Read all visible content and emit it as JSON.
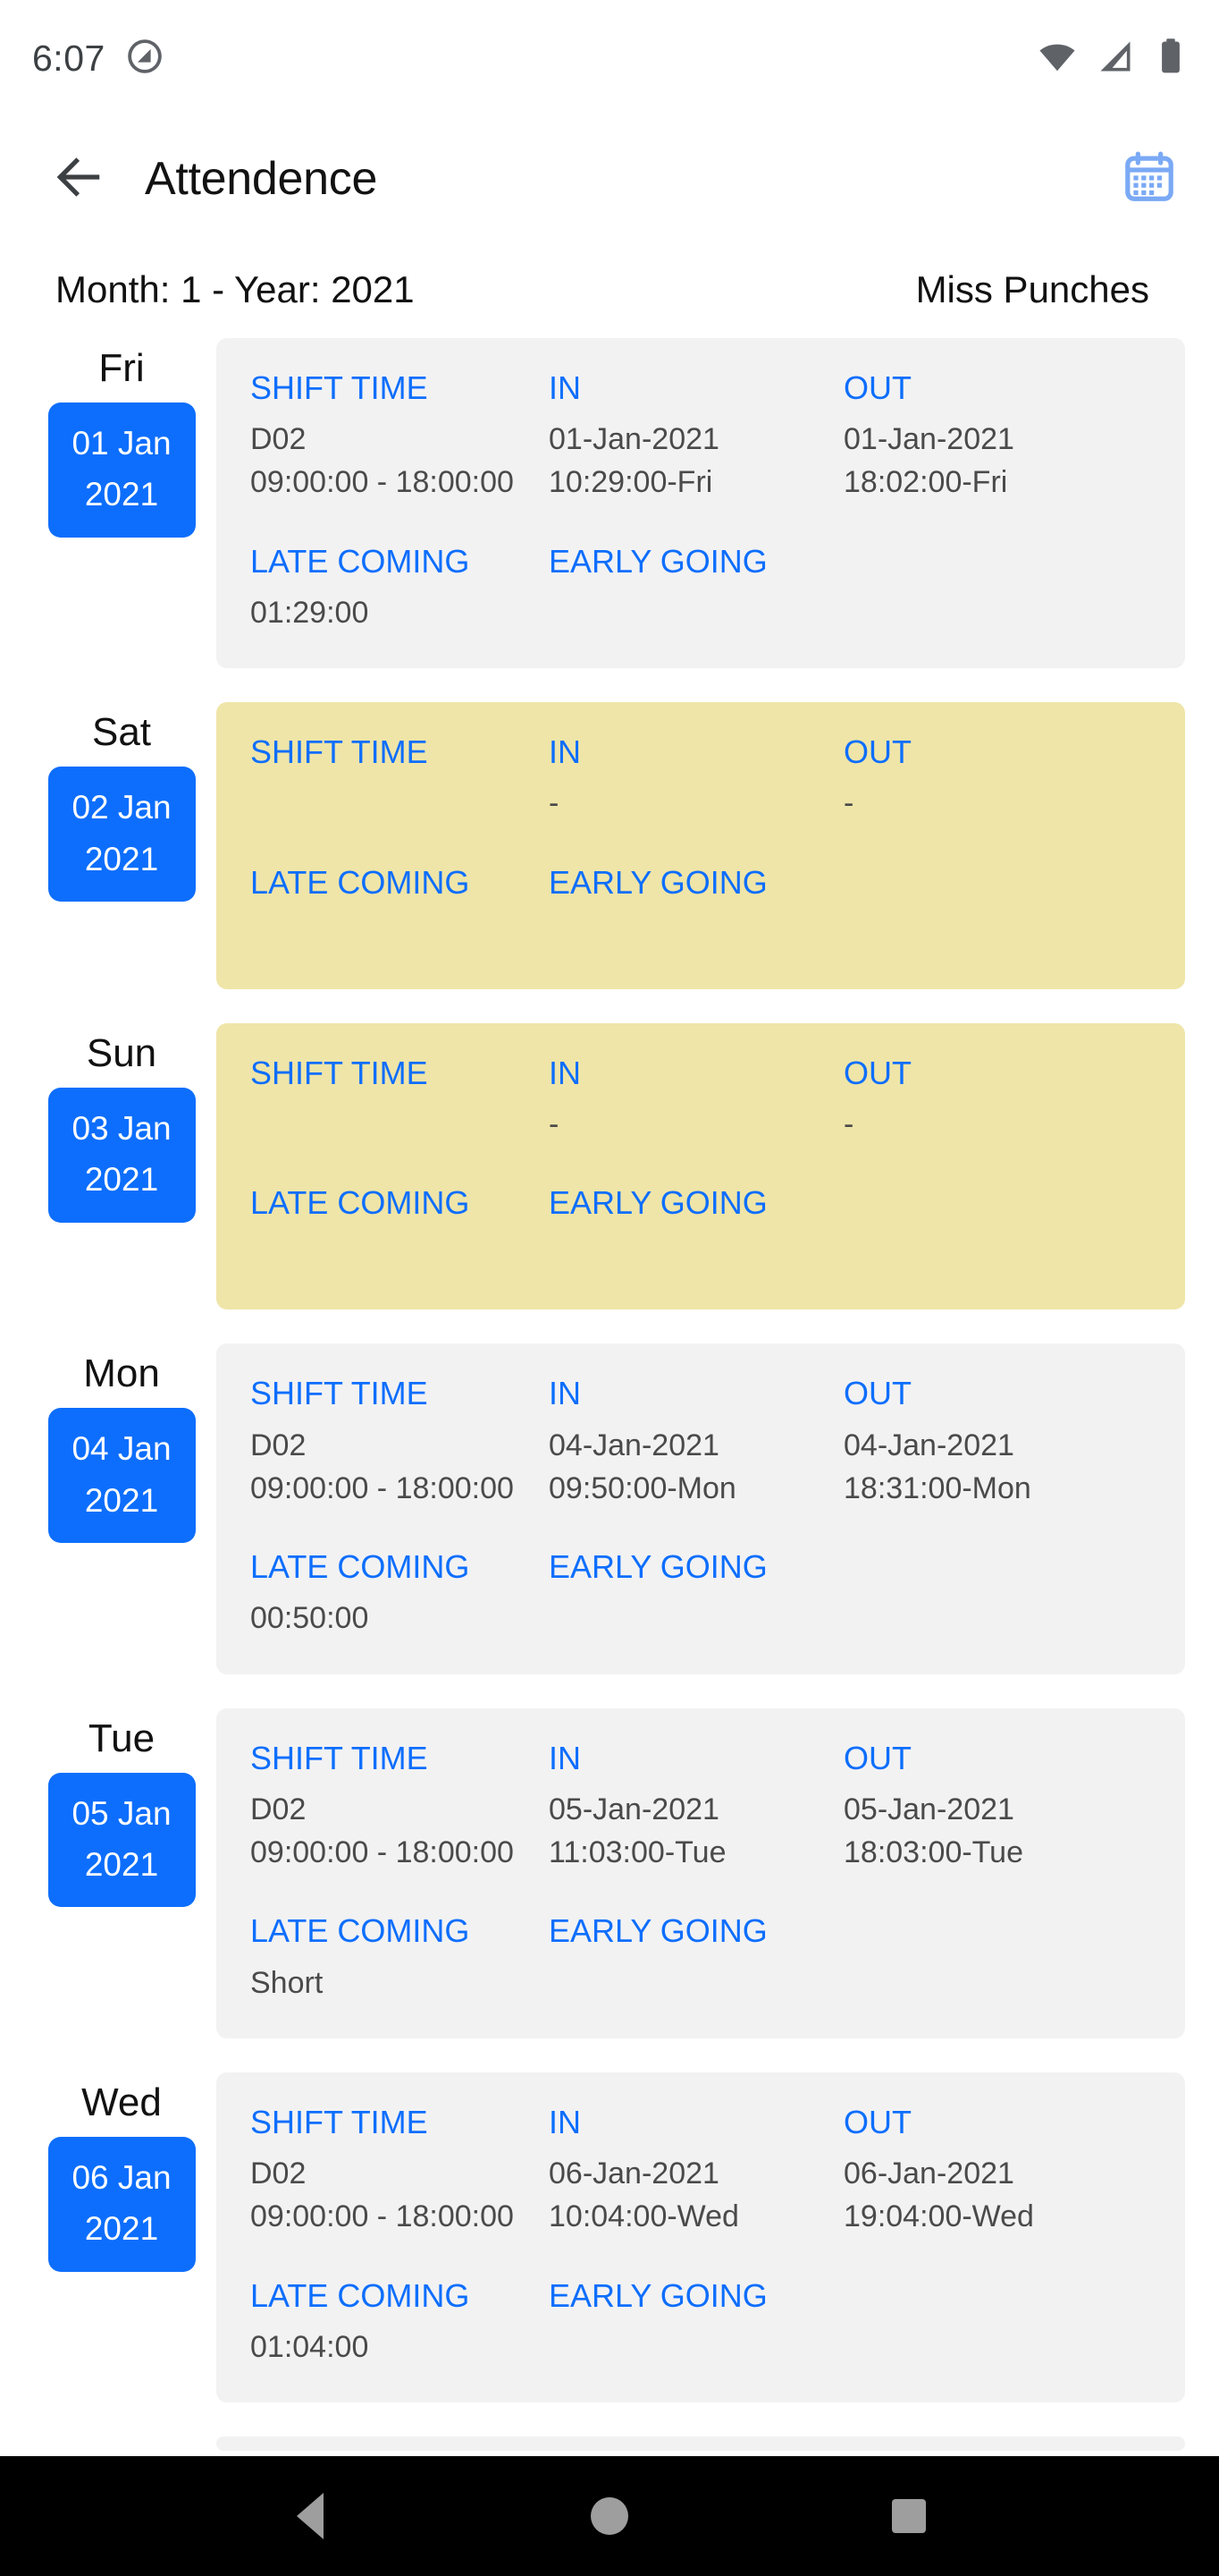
{
  "status_bar": {
    "clock": "6:07",
    "icons": [
      "dnd-icon",
      "wifi-icon",
      "cellular-icon",
      "battery-icon"
    ]
  },
  "app_bar": {
    "back_icon": "back-arrow-icon",
    "title": "Attendence",
    "calendar_icon": "calendar-icon",
    "accent_color": "#0d6efd",
    "calendar_icon_color": "#7aa9f5"
  },
  "filter": {
    "month_year": "Month: 1 - Year: 2021",
    "miss_punches": "Miss Punches"
  },
  "labels": {
    "shift_time": "SHIFT TIME",
    "in": "IN",
    "out": "OUT",
    "late_coming": "LATE COMING",
    "early_going": "EARLY GOING"
  },
  "colors": {
    "accent": "#0d6efd",
    "card_bg": "#f2f2f3",
    "weekend_bg": "#efe5a8",
    "value_text": "#4a4a4a",
    "nav_bar": "#000000"
  },
  "days": [
    {
      "dow": "Fri",
      "date": "01 Jan",
      "year": "2021",
      "weekend": false,
      "shift_code": "D02",
      "shift_time": "09:00:00 - 18:00:00",
      "in_date": "01-Jan-2021",
      "in_time": "10:29:00-Fri",
      "out_date": "01-Jan-2021",
      "out_time": "18:02:00-Fri",
      "late_coming": "01:29:00",
      "early_going": ""
    },
    {
      "dow": "Sat",
      "date": "02 Jan",
      "year": "2021",
      "weekend": true,
      "shift_code": "",
      "shift_time": "",
      "in_date": "-",
      "in_time": "",
      "out_date": "-",
      "out_time": "",
      "late_coming": "",
      "early_going": ""
    },
    {
      "dow": "Sun",
      "date": "03 Jan",
      "year": "2021",
      "weekend": true,
      "shift_code": "",
      "shift_time": "",
      "in_date": "-",
      "in_time": "",
      "out_date": "-",
      "out_time": "",
      "late_coming": "",
      "early_going": ""
    },
    {
      "dow": "Mon",
      "date": "04 Jan",
      "year": "2021",
      "weekend": false,
      "shift_code": "D02",
      "shift_time": "09:00:00 - 18:00:00",
      "in_date": "04-Jan-2021",
      "in_time": "09:50:00-Mon",
      "out_date": "04-Jan-2021",
      "out_time": "18:31:00-Mon",
      "late_coming": "00:50:00",
      "early_going": ""
    },
    {
      "dow": "Tue",
      "date": "05 Jan",
      "year": "2021",
      "weekend": false,
      "shift_code": "D02",
      "shift_time": "09:00:00 - 18:00:00",
      "in_date": "05-Jan-2021",
      "in_time": "11:03:00-Tue",
      "out_date": "05-Jan-2021",
      "out_time": "18:03:00-Tue",
      "late_coming": "Short",
      "early_going": ""
    },
    {
      "dow": "Wed",
      "date": "06 Jan",
      "year": "2021",
      "weekend": false,
      "shift_code": "D02",
      "shift_time": "09:00:00 - 18:00:00",
      "in_date": "06-Jan-2021",
      "in_time": "10:04:00-Wed",
      "out_date": "06-Jan-2021",
      "out_time": "19:04:00-Wed",
      "late_coming": "01:04:00",
      "early_going": ""
    }
  ],
  "nav_bar": {
    "back": "nav-back-icon",
    "home": "nav-home-icon",
    "recents": "nav-recents-icon"
  }
}
